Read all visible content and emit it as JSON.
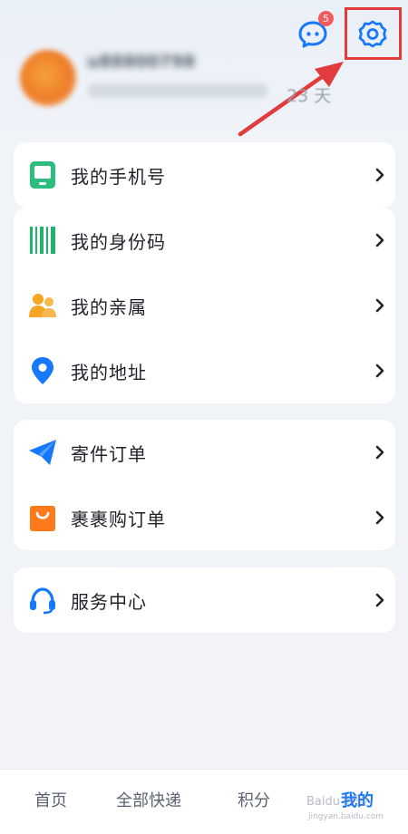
{
  "header": {
    "messages_badge": "5",
    "highlight_color": "#e23b3b"
  },
  "profile": {
    "username": "u88800798",
    "member_days": "23 天"
  },
  "menu_groups": [
    {
      "items": [
        {
          "label": "我的手机号",
          "icon": "phone-icon"
        }
      ]
    },
    {
      "items": [
        {
          "label": "我的身份码",
          "icon": "barcode-icon"
        },
        {
          "label": "我的亲属",
          "icon": "family-icon"
        },
        {
          "label": "我的地址",
          "icon": "location-pin-icon"
        }
      ]
    },
    {
      "items": [
        {
          "label": "寄件订单",
          "icon": "paper-plane-icon"
        },
        {
          "label": "裹裹购订单",
          "icon": "shopping-bag-icon"
        }
      ]
    },
    {
      "items": [
        {
          "label": "服务中心",
          "icon": "headset-icon"
        }
      ]
    }
  ],
  "bottom_nav": {
    "items": [
      {
        "label": "首页",
        "active": false
      },
      {
        "label": "全部快递",
        "active": false
      },
      {
        "label": "积分",
        "active": false
      },
      {
        "label": "我的",
        "active": true
      }
    ],
    "active_color": "#1677ff"
  },
  "watermark": {
    "text": "Baidu 经验",
    "url": "jingyan.baidu.com"
  },
  "colors": {
    "accent": "#1677ff",
    "badge": "#f25b5b",
    "phone_icon": "#2dbd7e",
    "barcode_icon": "#22b36b",
    "family_icon": "#f5a623",
    "location_icon": "#1677ff",
    "plane_icon": "#1677ff",
    "bag_icon": "#ff7a1a",
    "headset_icon": "#1677ff"
  }
}
